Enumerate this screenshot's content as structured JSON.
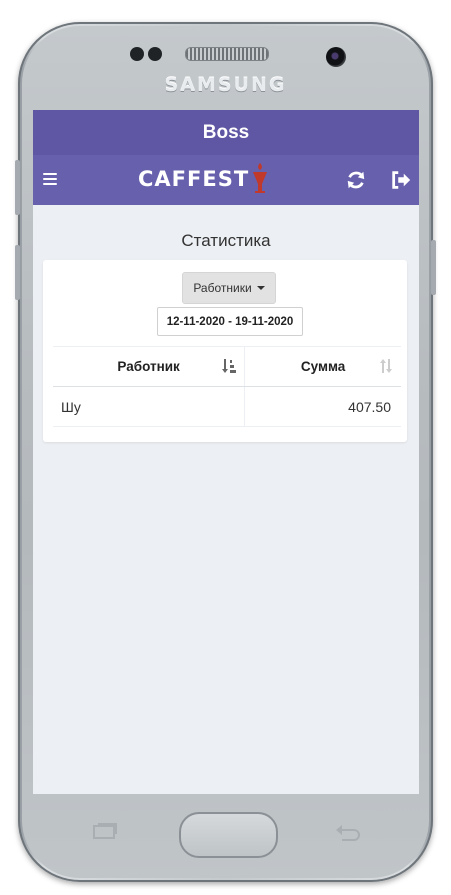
{
  "device": {
    "brand": "SAMSUNG"
  },
  "app": {
    "title": "Boss",
    "logo_text": "CAFFEST",
    "icons": {
      "menu": "hamburger-menu-icon",
      "refresh": "refresh-icon",
      "logout": "logout-icon"
    },
    "colors": {
      "header": "#5f57a3",
      "toolbar": "#6760ad",
      "logo_accent": "#c0392b"
    }
  },
  "page": {
    "title": "Статистика",
    "filter": {
      "dropdown_label": "Работники",
      "date_range": "12-11-2020 - 19-11-2020"
    },
    "table": {
      "columns": [
        "Работник",
        "Сумма"
      ],
      "rows": [
        {
          "name": "Шу",
          "sum": "407.50"
        }
      ]
    }
  }
}
